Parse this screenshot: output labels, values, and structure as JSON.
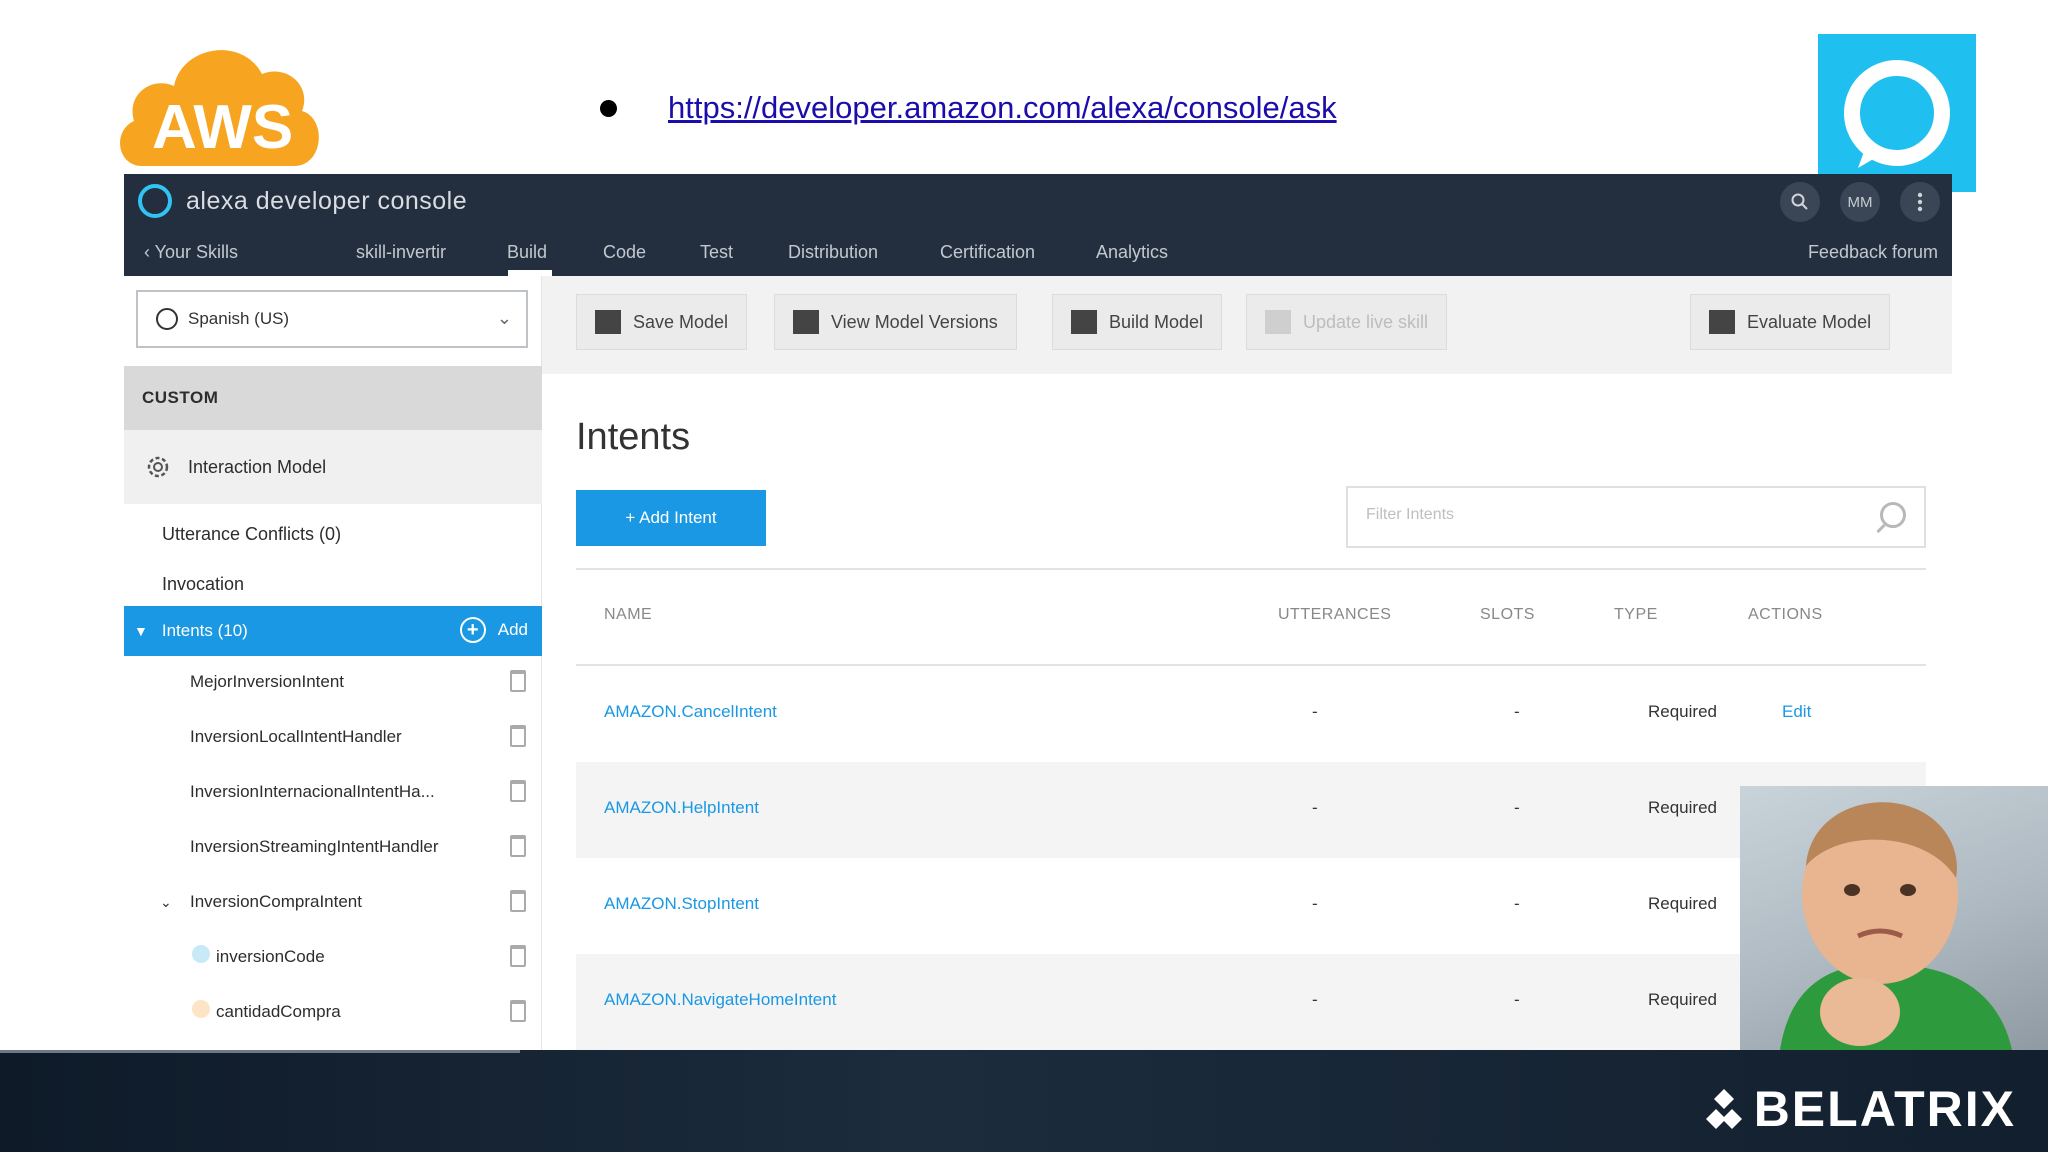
{
  "slide": {
    "link_url": "https://developer.amazon.com/alexa/console/ask",
    "footer_brand": "BELATRIX",
    "aws_logo_text": "AWS"
  },
  "console": {
    "title": "alexa developer console",
    "user_initials": "MM",
    "nav": {
      "back_label": "Your Skills",
      "skill_name": "skill-invertir",
      "tabs": [
        "Build",
        "Code",
        "Test",
        "Distribution",
        "Certification",
        "Analytics"
      ],
      "active_tab": "Build",
      "feedback_label": "Feedback forum"
    },
    "sidebar": {
      "language": "Spanish (US)",
      "section_header": "CUSTOM",
      "interaction_model_label": "Interaction Model",
      "utterance_conflicts_label": "Utterance Conflicts (0)",
      "invocation_label": "Invocation",
      "intents_label": "Intents (10)",
      "add_label": "Add",
      "intent_items": [
        "MejorInversionIntent",
        "InversionLocalIntentHandler",
        "InversionInternacionalIntentHa...",
        "InversionStreamingIntentHandler",
        "InversionCompraIntent"
      ],
      "slot_items": [
        "inversionCode",
        "cantidadCompra"
      ],
      "slot_colors": [
        "#c8e9f7",
        "#fde4c7"
      ]
    },
    "toolbar": {
      "save_model": "Save Model",
      "view_versions": "View Model Versions",
      "build_model": "Build Model",
      "update_live": "Update live skill",
      "evaluate_model": "Evaluate Model"
    },
    "main": {
      "heading": "Intents",
      "add_intent_label": "+ Add Intent",
      "filter_placeholder": "Filter Intents",
      "columns": [
        "NAME",
        "UTTERANCES",
        "SLOTS",
        "TYPE",
        "ACTIONS"
      ],
      "rows": [
        {
          "name": "AMAZON.CancelIntent",
          "utterances": "-",
          "slots": "-",
          "type": "Required",
          "action": "Edit"
        },
        {
          "name": "AMAZON.HelpIntent",
          "utterances": "-",
          "slots": "-",
          "type": "Required",
          "action": ""
        },
        {
          "name": "AMAZON.StopIntent",
          "utterances": "-",
          "slots": "-",
          "type": "Required",
          "action": ""
        },
        {
          "name": "AMAZON.NavigateHomeIntent",
          "utterances": "-",
          "slots": "-",
          "type": "Required",
          "action": ""
        }
      ]
    }
  },
  "colors": {
    "alexa_blue": "#1fbff0",
    "aws_orange": "#f7a520",
    "topbar": "#232f3e",
    "accent": "#1a98e3"
  }
}
